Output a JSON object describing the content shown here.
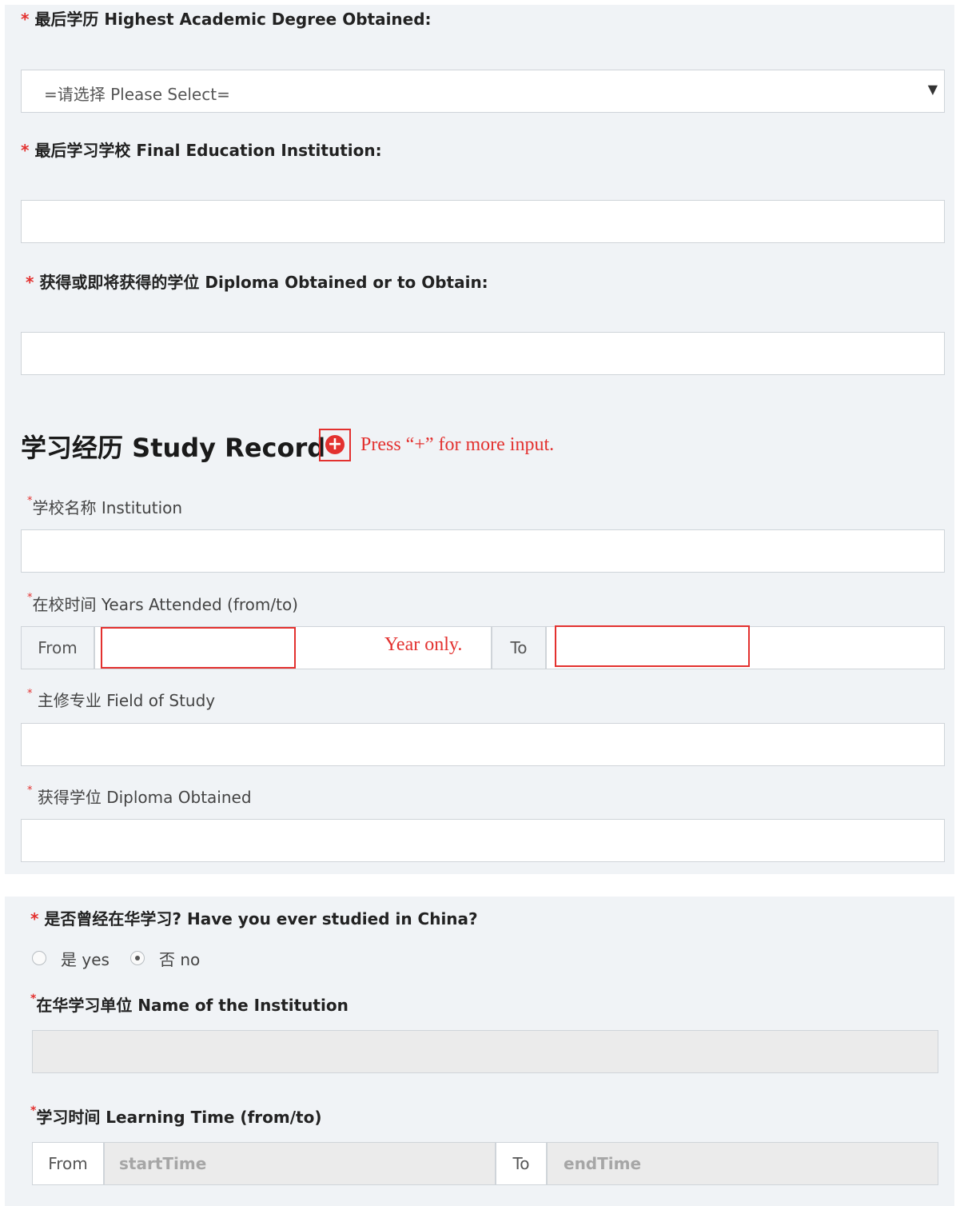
{
  "section1": {
    "degree": {
      "required_mark": "*",
      "label": "最后学历 Highest Academic Degree Obtained:",
      "select_value": "=请选择 Please Select=",
      "arrow": "▼"
    },
    "institution": {
      "required_mark": "*",
      "label": "最后学习学校 Final Education Institution:",
      "value": ""
    },
    "diploma": {
      "required_mark": "*",
      "label": "获得或即将获得的学位 Diploma Obtained or to Obtain:",
      "value": ""
    }
  },
  "study_record": {
    "heading": "学习经历 Study Record",
    "add_icon": "plus-circle-icon",
    "note": "Press “+” for more input.",
    "institution": {
      "required_mark": "*",
      "label": "学校名称 Institution",
      "value": ""
    },
    "years": {
      "required_mark": "*",
      "label": "在校时间 Years Attended (from/to)",
      "from_label": "From",
      "to_label": "To",
      "note": "Year only.",
      "from_value": "",
      "to_value": ""
    },
    "field": {
      "required_mark": "*",
      "label": " 主修专业 Field of Study",
      "value": ""
    },
    "diploma": {
      "required_mark": "*",
      "label": " 获得学位 Diploma Obtained",
      "value": ""
    }
  },
  "china": {
    "question": {
      "required_mark": "*",
      "label": " 是否曾经在华学习? Have you ever studied in China?"
    },
    "options": [
      {
        "label": "是 yes",
        "checked": false
      },
      {
        "label": "否 no",
        "checked": true
      }
    ],
    "institution": {
      "required_mark": "*",
      "label": "在华学习单位 Name of the Institution",
      "value": ""
    },
    "time": {
      "required_mark": "*",
      "label": "学习时间 Learning Time (from/to)",
      "from_label": "From",
      "to_label": "To",
      "start_placeholder": "startTime",
      "end_placeholder": "endTime"
    }
  },
  "colors": {
    "accent_red": "#e3312f",
    "panel_bg": "#f0f3f6",
    "border": "#cfd4d9"
  }
}
